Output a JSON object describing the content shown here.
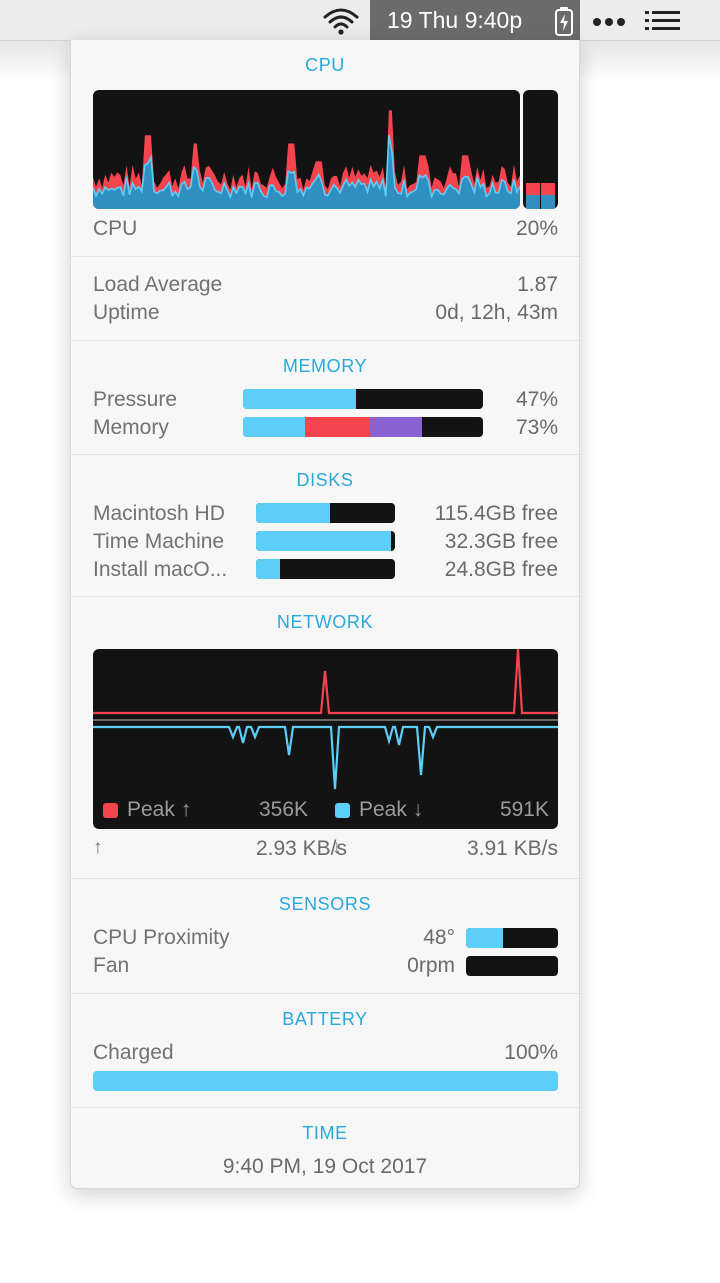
{
  "menubar": {
    "clock_text": "19 Thu 9:40p",
    "icons": [
      "wifi-icon",
      "battery-charging-icon",
      "more-dots-icon",
      "list-menu-icon"
    ]
  },
  "colors": {
    "accent_header": "#29a8dc",
    "bar_blue": "#5ccef8",
    "bar_red": "#f5444d",
    "bar_purple": "#8a63d2",
    "bar_track": "#131313"
  },
  "cpu": {
    "header": "CPU",
    "label": "CPU",
    "value": "20%",
    "load_label": "Load Average",
    "load_value": "1.87",
    "uptime_label": "Uptime",
    "uptime_value": "0d, 12h, 43m"
  },
  "memory": {
    "header": "MEMORY",
    "pressure_label": "Pressure",
    "pressure_value": "47%",
    "pressure_fraction": 0.47,
    "memory_label": "Memory",
    "memory_value": "73%",
    "memory_segments": [
      {
        "color": "#5ccef8",
        "fraction": 0.26
      },
      {
        "color": "#f5444d",
        "fraction": 0.27
      },
      {
        "color": "#8a63d2",
        "fraction": 0.215
      }
    ]
  },
  "disks": {
    "header": "DISKS",
    "items": [
      {
        "name": "Macintosh HD",
        "free": "115.4GB free",
        "used_fraction": 0.53
      },
      {
        "name": "Time Machine",
        "free": "32.3GB free",
        "used_fraction": 0.97
      },
      {
        "name": "Install macO...",
        "free": "24.8GB free",
        "used_fraction": 0.17
      }
    ]
  },
  "network": {
    "header": "NETWORK",
    "peak_up_label": "Peak ↑",
    "peak_up_value": "356K",
    "peak_down_label": "Peak ↓",
    "peak_down_value": "591K",
    "up_arrow": "↑",
    "up_rate": "2.93 KB/s",
    "down_arrow": "↓",
    "down_rate": "3.91 KB/s"
  },
  "sensors": {
    "header": "SENSORS",
    "cpu_label": "CPU Proximity",
    "cpu_value": "48°",
    "cpu_fraction": 0.4,
    "fan_label": "Fan",
    "fan_value": "0rpm",
    "fan_fraction": 0
  },
  "battery": {
    "header": "BATTERY",
    "status_label": "Charged",
    "percent": "100%",
    "fraction": 1.0
  },
  "time": {
    "header": "TIME",
    "value": "9:40 PM, 19 Oct 2017"
  }
}
